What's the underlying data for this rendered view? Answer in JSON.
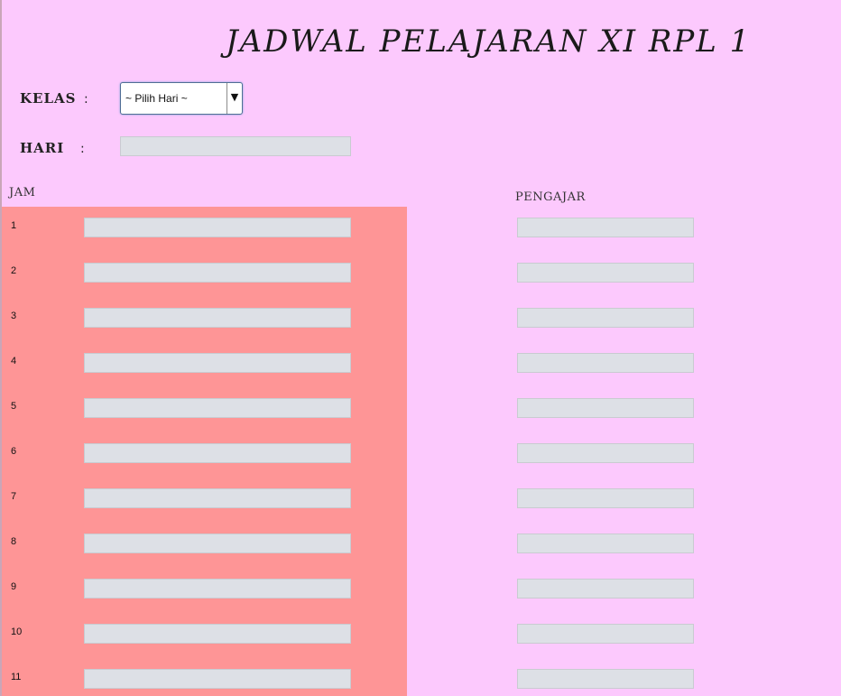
{
  "page": {
    "title": "JADWAL PELAJARAN XI RPL 1",
    "background": "#fcc9fd",
    "panel_color": "#fe9596"
  },
  "form": {
    "kelas_label": "KELAS",
    "hari_label": "HARI",
    "colon": ":",
    "kelas_select": {
      "selected": "~ Pilih Hari ~",
      "arrow": "▼"
    },
    "hari_value": ""
  },
  "schedule": {
    "jam_header": "JAM",
    "pengajar_header": "PENGAJAR",
    "rows": [
      {
        "jam": "1",
        "mapel": "",
        "pengajar": ""
      },
      {
        "jam": "2",
        "mapel": "",
        "pengajar": ""
      },
      {
        "jam": "3",
        "mapel": "",
        "pengajar": ""
      },
      {
        "jam": "4",
        "mapel": "",
        "pengajar": ""
      },
      {
        "jam": "5",
        "mapel": "",
        "pengajar": ""
      },
      {
        "jam": "6",
        "mapel": "",
        "pengajar": ""
      },
      {
        "jam": "7",
        "mapel": "",
        "pengajar": ""
      },
      {
        "jam": "8",
        "mapel": "",
        "pengajar": ""
      },
      {
        "jam": "9",
        "mapel": "",
        "pengajar": ""
      },
      {
        "jam": "10",
        "mapel": "",
        "pengajar": ""
      },
      {
        "jam": "11",
        "mapel": "",
        "pengajar": ""
      }
    ]
  }
}
